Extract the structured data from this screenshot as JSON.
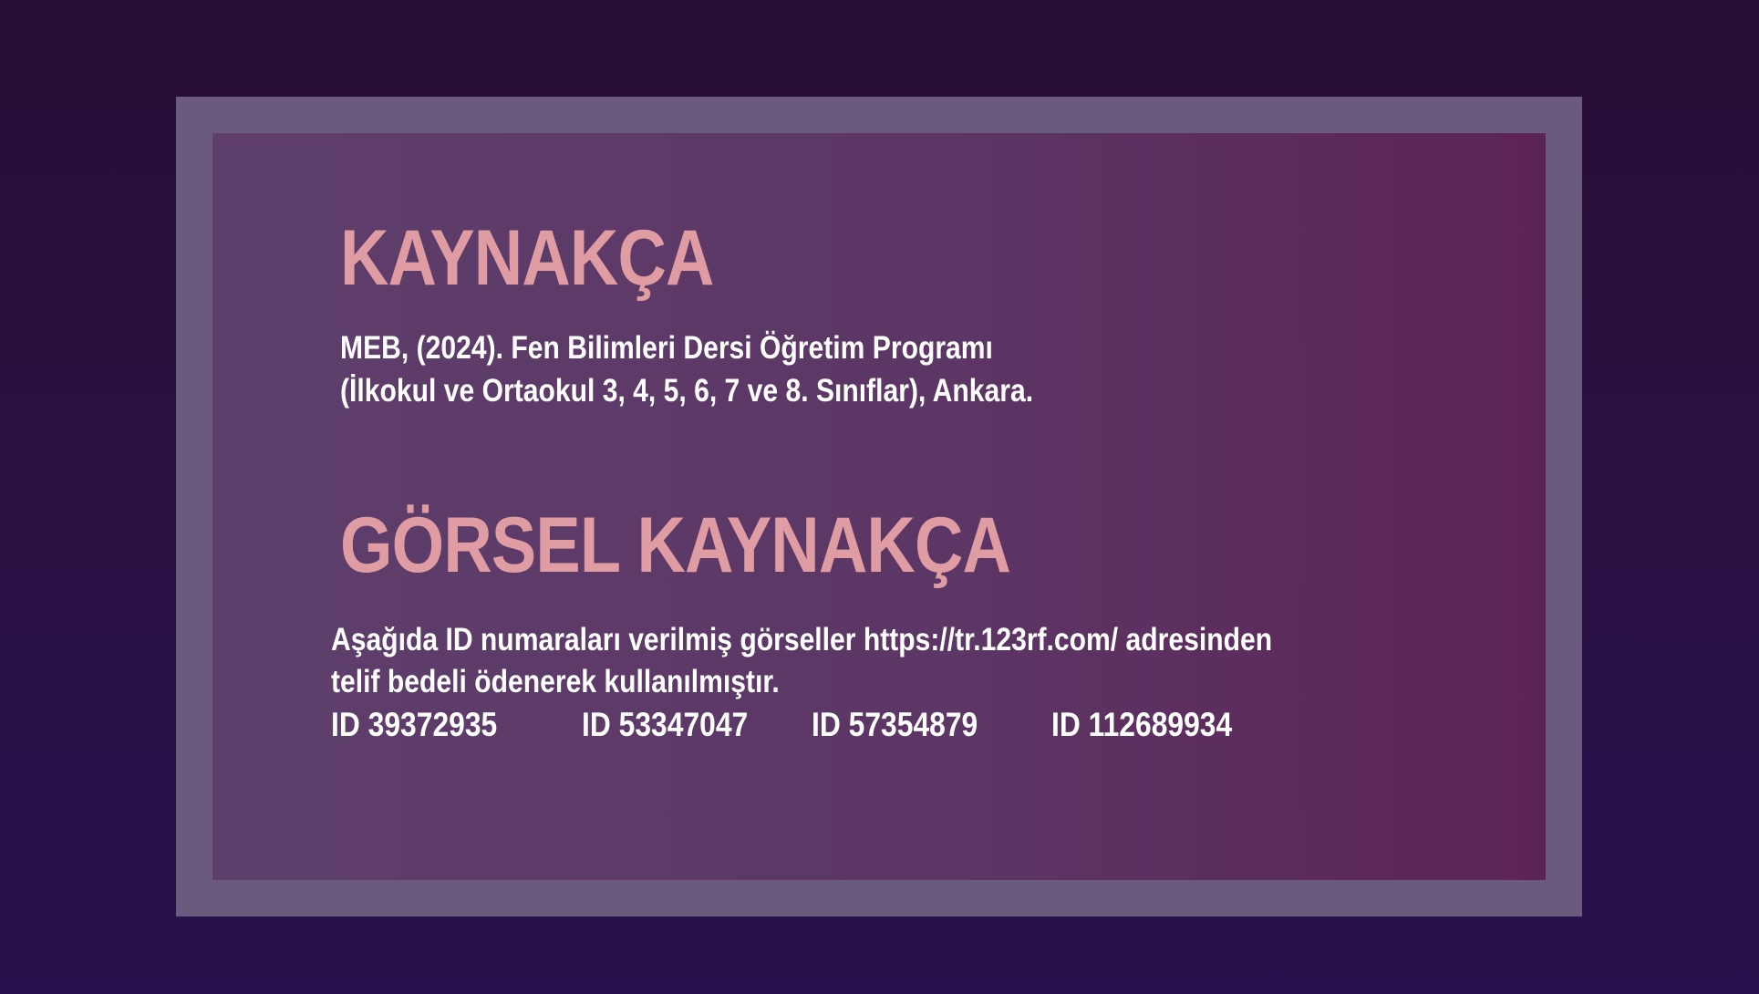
{
  "slide": {
    "title": "KAYNAKÇA",
    "reference": {
      "line1": "MEB, (2024). Fen Bilimleri Dersi Öğretim Programı",
      "line2": "(İlkokul ve Ortaokul 3, 4, 5, 6, 7 ve 8. Sınıflar), Ankara."
    },
    "visual_title": "GÖRSEL KAYNAKÇA",
    "visual_note": {
      "line1": "Aşağıda ID numaraları verilmiş görseller https://tr.123rf.com/ adresinden",
      "line2": "telif bedeli ödenerek kullanılmıştır."
    },
    "image_ids": [
      "ID 39372935",
      "ID 53347047",
      "ID 57354879",
      "ID 112689934"
    ]
  },
  "colors": {
    "background": "#2a1245",
    "frame": "#6a5a7e",
    "panel": "#5e3f6b",
    "heading": "#e09ca3",
    "text": "#ffffff"
  }
}
